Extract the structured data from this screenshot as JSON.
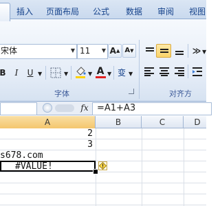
{
  "tabs": {
    "home": "",
    "insert": "插入",
    "page_layout": "页面布局",
    "formulas": "公式",
    "data": "数据",
    "review": "审阅",
    "view": "视图"
  },
  "ribbon": {
    "font_name": "宋体",
    "font_size": "11",
    "increase_font": "A",
    "decrease_font": "A",
    "bold": "B",
    "italic": "I",
    "underline": "U",
    "font_color": "A",
    "phonetic": "变",
    "font_group_label": "字体",
    "align_group_label": "对齐方"
  },
  "formula_bar": {
    "fx": "fx",
    "formula": "=A1+A3"
  },
  "columns": [
    "A",
    "B",
    "C",
    "D"
  ],
  "cells": {
    "b1": "2",
    "b2": "3",
    "a3": "s678.com",
    "a4": "#VALUE!"
  },
  "colors": {
    "accent": "#15428b",
    "ribbon": "#dfe8f5",
    "selection": "#000000",
    "font_color_bar": "#e02020",
    "fill_color_bar": "#ffd200"
  }
}
